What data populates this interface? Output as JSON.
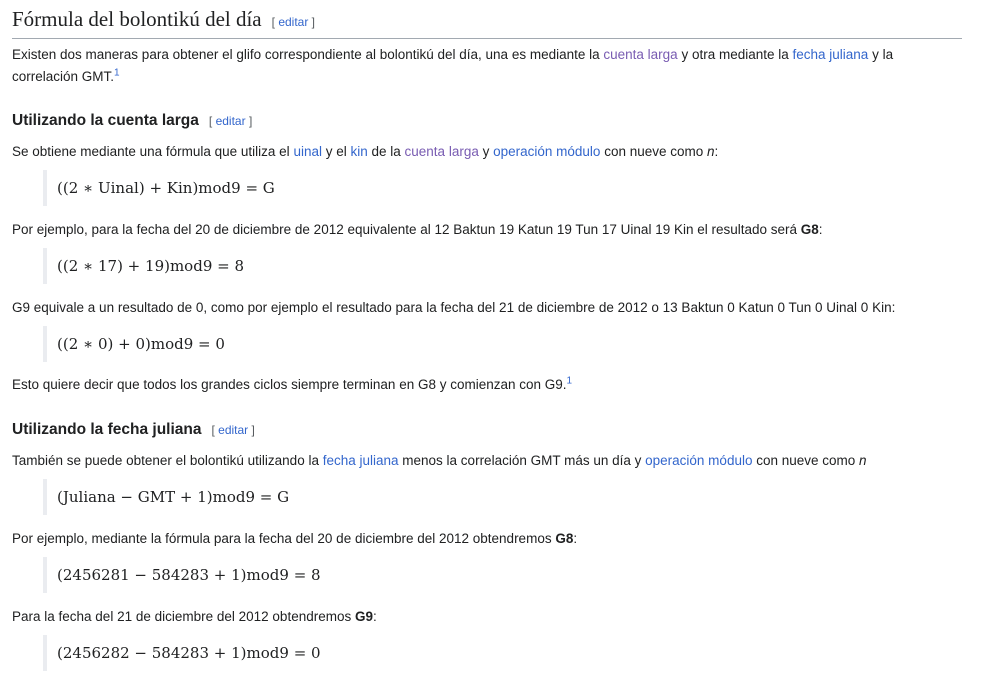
{
  "heading": {
    "title": "Fórmula del bolontikú del día",
    "edit": "editar"
  },
  "intro": {
    "t1": "Existen dos maneras para obtener el glifo correspondiente al bolontikú del día, una es mediante la ",
    "l1": "cuenta larga",
    "t2": " y otra mediante la ",
    "l2": "fecha juliana",
    "t3": " y la correlación GMT.",
    "ref": "1"
  },
  "sec1": {
    "title": "Utilizando la cuenta larga",
    "edit": "editar",
    "p1": {
      "t1": "Se obtiene mediante una fórmula que utiliza el ",
      "l1": "uinal",
      "t2": " y el ",
      "l2": "kin",
      "t3": " de la ",
      "l3": "cuenta larga",
      "t4": " y ",
      "l4": "operación módulo",
      "t5": " con nueve como ",
      "var": "n",
      "t6": ":"
    },
    "f1": "((2 ∗ Uinal) + Kin)mod9 = G",
    "p2": {
      "t1": "Por ejemplo, para la fecha del 20 de diciembre de 2012 equivalente al 12 Baktun 19 Katun 19 Tun 17 Uinal 19 Kin el resultado será ",
      "b": "G8",
      "t2": ":"
    },
    "f2": "((2 ∗ 17) + 19)mod9 = 8",
    "p3": "G9 equivale a un resultado de 0, como por ejemplo el resultado para la fecha del 21 de diciembre de 2012 o 13 Baktun 0 Katun 0 Tun 0 Uinal 0 Kin:",
    "f3": "((2 ∗ 0) + 0)mod9 = 0",
    "p4": {
      "t1": "Esto quiere decir que todos los grandes ciclos siempre terminan en G8 y comienzan con G9.",
      "ref": "1"
    }
  },
  "sec2": {
    "title": "Utilizando la fecha juliana",
    "edit": "editar",
    "p1": {
      "t1": "También se puede obtener el bolontikú utilizando la ",
      "l1": "fecha juliana",
      "t2": " menos la correlación GMT más un día y ",
      "l2": "operación módulo",
      "t3": " con nueve como ",
      "var": "n"
    },
    "f1": "(Juliana − GMT + 1)mod9 = G",
    "p2": {
      "t1": "Por ejemplo, mediante la fórmula para la fecha del 20 de diciembre del 2012 obtendremos ",
      "b": "G8",
      "t2": ":"
    },
    "f2": "(2456281 − 584283 + 1)mod9 = 8",
    "p3": {
      "t1": "Para la fecha del 21 de diciembre del 2012 obtendremos ",
      "b": "G9",
      "t2": ":"
    },
    "f3": "(2456282 − 584283 + 1)mod9 = 0"
  },
  "colors": {
    "link": "#3366cc",
    "visited_link": "#795cb2",
    "text": "#202122",
    "rule": "#a2a9b1"
  }
}
